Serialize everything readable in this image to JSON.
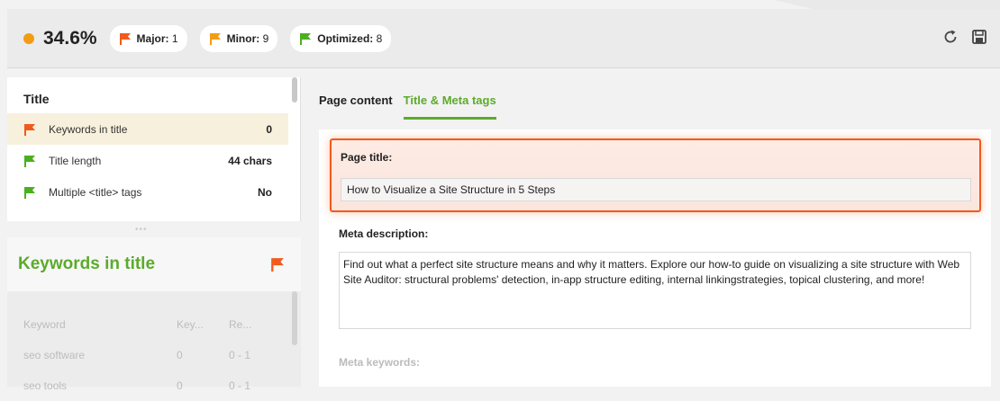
{
  "topbar": {
    "score": "34.6%",
    "pills": [
      {
        "label": "Major:",
        "count": "1",
        "color": "#f05a1c"
      },
      {
        "label": "Minor:",
        "count": "9",
        "color": "#f39c12"
      },
      {
        "label": "Optimized:",
        "count": "8",
        "color": "#4caf1f"
      }
    ],
    "icons": [
      "refresh-icon",
      "save-icon"
    ]
  },
  "left": {
    "section_title": "Title",
    "issues": [
      {
        "label": "Keywords in title",
        "value": "0",
        "flag_color": "#f05a1c"
      },
      {
        "label": "Title length",
        "value": "44 chars",
        "flag_color": "#4caf1f"
      },
      {
        "label": "Multiple <title> tags",
        "value": "No",
        "flag_color": "#4caf1f"
      }
    ],
    "detail_title": "Keywords in title",
    "table": {
      "headers": [
        "Keyword",
        "Key...",
        "Re..."
      ],
      "rows": [
        [
          "seo software",
          "0",
          "0 - 1"
        ],
        [
          "seo tools",
          "0",
          "0 - 1"
        ]
      ]
    }
  },
  "right": {
    "tabs": [
      {
        "label": "Page content",
        "active": false
      },
      {
        "label": "Title & Meta tags",
        "active": true
      }
    ],
    "page_title_label": "Page title:",
    "page_title_value": "How to Visualize a Site Structure in 5 Steps",
    "meta_description_label": "Meta description:",
    "meta_description_value": "Find out what a perfect site structure means and why it matters. Explore our how-to guide on visualizing a site structure with WebSite Auditor: structural problems' detection, in-app structure editing, internal linkingstrategies, topical clustering, and more!",
    "meta_keywords_label": "Meta keywords:"
  },
  "colors": {
    "accent_green": "#5cab2b",
    "highlight": "#f05a1c"
  }
}
